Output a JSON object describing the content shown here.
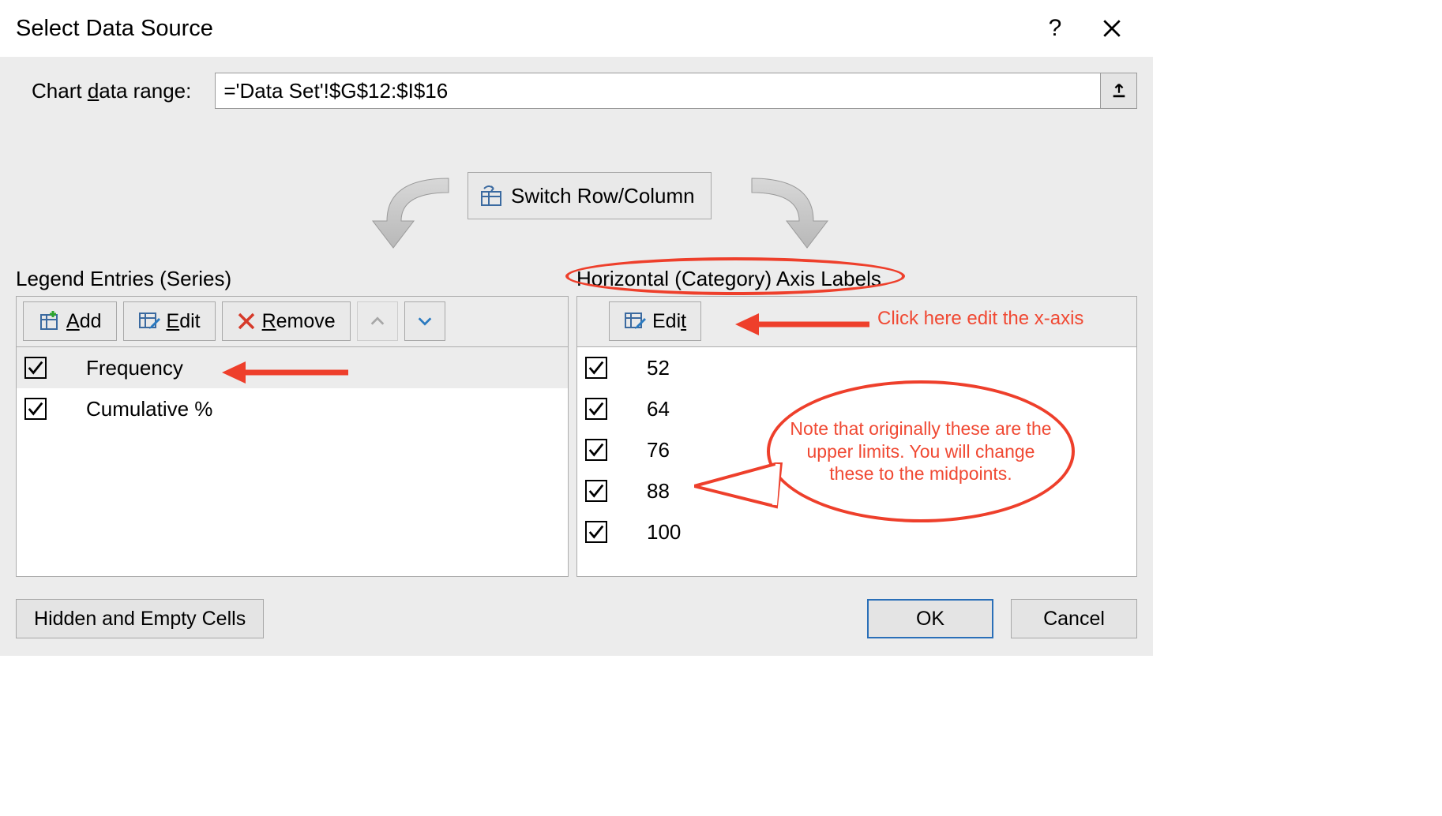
{
  "dialog": {
    "title": "Select Data Source",
    "help_symbol": "?",
    "close_label": "Close"
  },
  "range": {
    "label_pre": "Chart ",
    "label_u": "d",
    "label_post": "ata range:",
    "value": "='Data Set'!$G$12:$I$16"
  },
  "switch": {
    "label_pre": "S",
    "label_u": "w",
    "label_post": "itch Row/Column"
  },
  "series_section": {
    "title_pre": "Legend Entries (",
    "title_u": "S",
    "title_post": "eries)",
    "buttons": {
      "add": {
        "u": "A",
        "rest": "dd"
      },
      "edit": {
        "u": "E",
        "rest": "dit"
      },
      "remove": {
        "u": "R",
        "rest": "emove"
      }
    },
    "items": [
      {
        "checked": true,
        "label": "Frequency",
        "selected": true
      },
      {
        "checked": true,
        "label": "Cumulative %",
        "selected": false
      }
    ]
  },
  "axis_section": {
    "title_pre": "Horizontal (",
    "title_u": "C",
    "title_post": "ategory) Axis Labels",
    "edit": {
      "pre": "Edi",
      "u": "t"
    },
    "items": [
      {
        "checked": true,
        "label": "52"
      },
      {
        "checked": true,
        "label": "64"
      },
      {
        "checked": true,
        "label": "76"
      },
      {
        "checked": true,
        "label": "88"
      },
      {
        "checked": true,
        "label": "100"
      }
    ]
  },
  "footer": {
    "hidden_pre": "",
    "hidden_u": "H",
    "hidden_post": "idden and Empty Cells",
    "ok": "OK",
    "cancel": "Cancel"
  },
  "annotations": {
    "edit_hint": "Click here edit the x-axis",
    "callout": "Note that originally these are the upper limits. You will change these to the midpoints."
  }
}
